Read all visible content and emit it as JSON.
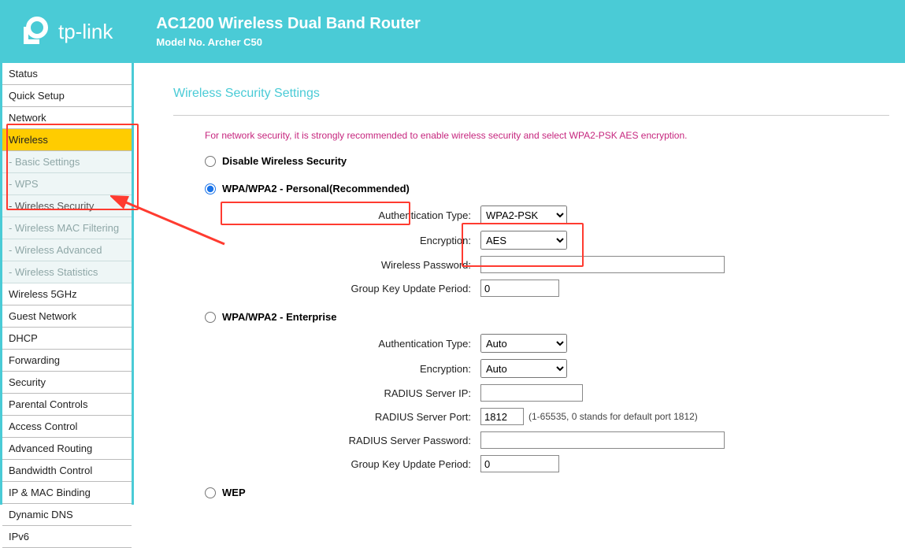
{
  "header": {
    "brand": "tp-link",
    "title": "AC1200 Wireless Dual Band Router",
    "model": "Model No. Archer C50"
  },
  "sidebar": {
    "items": [
      {
        "label": "Status"
      },
      {
        "label": "Quick Setup"
      },
      {
        "label": "Network"
      },
      {
        "label": "Wireless",
        "active": true
      },
      {
        "label": "Wireless 5GHz"
      },
      {
        "label": "Guest Network"
      },
      {
        "label": "DHCP"
      },
      {
        "label": "Forwarding"
      },
      {
        "label": "Security"
      },
      {
        "label": "Parental Controls"
      },
      {
        "label": "Access Control"
      },
      {
        "label": "Advanced Routing"
      },
      {
        "label": "Bandwidth Control"
      },
      {
        "label": "IP & MAC Binding"
      },
      {
        "label": "Dynamic DNS"
      },
      {
        "label": "IPv6"
      }
    ],
    "wireless_sub": [
      {
        "label": "- Basic Settings"
      },
      {
        "label": "- WPS"
      },
      {
        "label": "- Wireless Security"
      },
      {
        "label": "- Wireless MAC Filtering"
      },
      {
        "label": "- Wireless Advanced"
      },
      {
        "label": "- Wireless Statistics"
      }
    ]
  },
  "page": {
    "title": "Wireless Security Settings",
    "notice": "For network security, it is strongly recommended to enable wireless security and select WPA2-PSK AES encryption."
  },
  "options": {
    "disable": {
      "label": "Disable Wireless Security"
    },
    "personal": {
      "label": "WPA/WPA2 - Personal(Recommended)",
      "auth_label": "Authentication Type:",
      "auth_value": "WPA2-PSK",
      "enc_label": "Encryption:",
      "enc_value": "AES",
      "pwd_label": "Wireless Password:",
      "pwd_value": "",
      "gkup_label": "Group Key Update Period:",
      "gkup_value": "0"
    },
    "enterprise": {
      "label": "WPA/WPA2 - Enterprise",
      "auth_label": "Authentication Type:",
      "auth_value": "Auto",
      "enc_label": "Encryption:",
      "enc_value": "Auto",
      "ip_label": "RADIUS Server IP:",
      "ip_value": "",
      "port_label": "RADIUS Server Port:",
      "port_value": "1812",
      "port_hint": "(1-65535, 0 stands for default port 1812)",
      "rpwd_label": "RADIUS Server Password:",
      "rpwd_value": "",
      "gkup_label": "Group Key Update Period:",
      "gkup_value": "0"
    },
    "wep": {
      "label": "WEP"
    }
  }
}
